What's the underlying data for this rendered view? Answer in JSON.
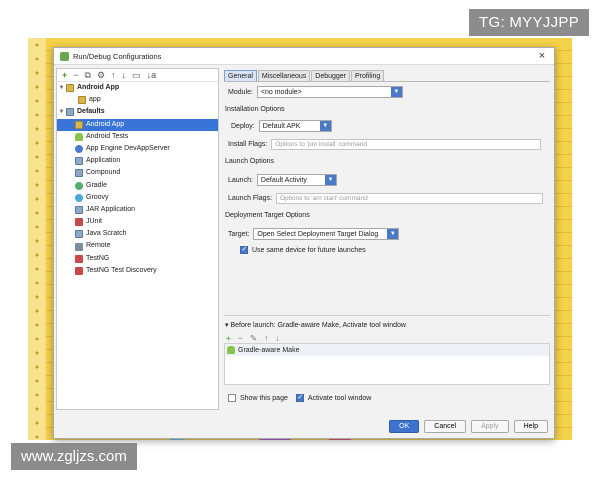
{
  "watermarks": {
    "top": "TG: MYYJJPP",
    "bottom": "www.zgljzs.com"
  },
  "dialog": {
    "title": "Run/Debug Configurations",
    "close_glyph": "×"
  },
  "toolbar": {
    "add": "+",
    "remove": "−",
    "copy": "⧉",
    "settings": "⚙",
    "up": "↑",
    "down": "↓",
    "folder": "▭",
    "sort": "↓a"
  },
  "tree": {
    "android_app": "Android App",
    "app": "app",
    "defaults": "Defaults",
    "items": [
      "Android App",
      "Android Tests",
      "App Engine DevAppServer",
      "Application",
      "Compound",
      "Gradle",
      "Groovy",
      "JAR Application",
      "JUnit",
      "Java Scratch",
      "Remote",
      "TestNG",
      "TestNG Test Discovery"
    ]
  },
  "tabs": [
    "General",
    "Miscellaneous",
    "Debugger",
    "Profiling"
  ],
  "general": {
    "module_label": "Module:",
    "module_value": "<no module>",
    "installation_options": "Installation Options",
    "deploy_label": "Deploy:",
    "deploy_value": "Default APK",
    "install_flags_label": "Install Flags:",
    "install_flags_placeholder": "Options to 'pm install' command",
    "launch_options": "Launch Options",
    "launch_label": "Launch:",
    "launch_value": "Default Activity",
    "launch_flags_label": "Launch Flags:",
    "launch_flags_placeholder": "Options to 'am start' command",
    "deployment_target_options": "Deployment Target Options",
    "target_label": "Target:",
    "target_value": "Open Select Deployment Target Dialog",
    "same_device_label": "Use same device for future launches",
    "same_device_checked": true,
    "before_launch": "▾ Before launch: Gradle-aware Make, Activate tool window",
    "before_launch_item": "Gradle-aware Make",
    "show_page_label": "Show this page",
    "show_page_checked": false,
    "activate_tool_label": "Activate tool window",
    "activate_tool_checked": true
  },
  "bl_toolbar": {
    "add": "+",
    "remove": "−",
    "edit": "✎",
    "up": "↑",
    "down": "↓"
  },
  "buttons": {
    "ok": "OK",
    "cancel": "Cancel",
    "apply": "Apply",
    "help": "Help"
  },
  "colors": {
    "accent": "#3f73d0",
    "selection": "#3875d7",
    "background": "#f4d24a"
  }
}
